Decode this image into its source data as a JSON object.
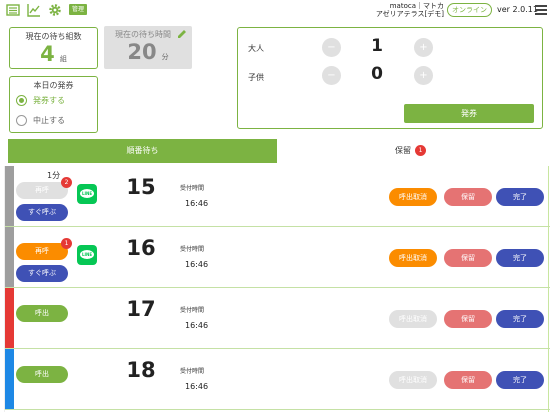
{
  "header": {
    "admin_badge": "管理",
    "store_line1": "matoca｜マトカ",
    "store_line2": "アゼリアテラス[デモ]",
    "status_button": "オンライン",
    "version": "ver 2.0.11",
    "icons": [
      "list-icon",
      "chart-icon",
      "gear-icon",
      "menu-icon"
    ]
  },
  "stats": {
    "wait_groups_title": "現在の待ち組数",
    "wait_groups_value": "4",
    "wait_groups_unit": "組",
    "wait_time_title": "現在の待ち時間",
    "wait_time_value": "20",
    "wait_time_unit": "分"
  },
  "today": {
    "title": "本日の発券",
    "option_issue": "発券する",
    "option_stop": "中止する",
    "selected": "発券する"
  },
  "issue_panel": {
    "adult_label": "大人",
    "adult_value": "1",
    "child_label": "子供",
    "child_value": "0",
    "minus": "−",
    "plus": "+",
    "issue_button": "発券"
  },
  "tabs": {
    "waiting": "順番待ち",
    "hold": "保留",
    "hold_count": "1"
  },
  "colors": {
    "accent_green": "#7cb342",
    "orange": "#fb8c00",
    "salmon": "#e57373",
    "indigo": "#3f51b5",
    "line_green": "#06c755",
    "badge_red": "#e53935",
    "disabled": "#e0e0e0"
  },
  "rows": [
    {
      "strip_color": "#9e9e9e",
      "elapsed": "1分",
      "call_label": "再呼",
      "call_count": "2",
      "call_style": "disabled",
      "sugu_label": "すぐ呼ぶ",
      "line_text": "LINE",
      "number": "15",
      "recv_label": "受付時間",
      "recv_time": "16:46",
      "cancel_label": "呼出取消",
      "cancel_active": true,
      "hold_label": "保留",
      "done_label": "完了"
    },
    {
      "strip_color": "#9e9e9e",
      "elapsed": "",
      "call_label": "再呼",
      "call_count": "1",
      "call_style": "orange",
      "sugu_label": "すぐ呼ぶ",
      "line_text": "LINE",
      "number": "16",
      "recv_label": "受付時間",
      "recv_time": "16:46",
      "cancel_label": "呼出取消",
      "cancel_active": true,
      "hold_label": "保留",
      "done_label": "完了"
    },
    {
      "strip_color": "#e53935",
      "elapsed": "",
      "call_label": "呼出",
      "call_count": "",
      "call_style": "green",
      "sugu_label": "",
      "line_text": "",
      "number": "17",
      "recv_label": "受付時間",
      "recv_time": "16:46",
      "cancel_label": "呼出取消",
      "cancel_active": false,
      "hold_label": "保留",
      "done_label": "完了"
    },
    {
      "strip_color": "#1e88e5",
      "elapsed": "",
      "call_label": "呼出",
      "call_count": "",
      "call_style": "green",
      "sugu_label": "",
      "line_text": "",
      "number": "18",
      "recv_label": "受付時間",
      "recv_time": "16:46",
      "cancel_label": "呼出取消",
      "cancel_active": false,
      "hold_label": "保留",
      "done_label": "完了"
    }
  ]
}
